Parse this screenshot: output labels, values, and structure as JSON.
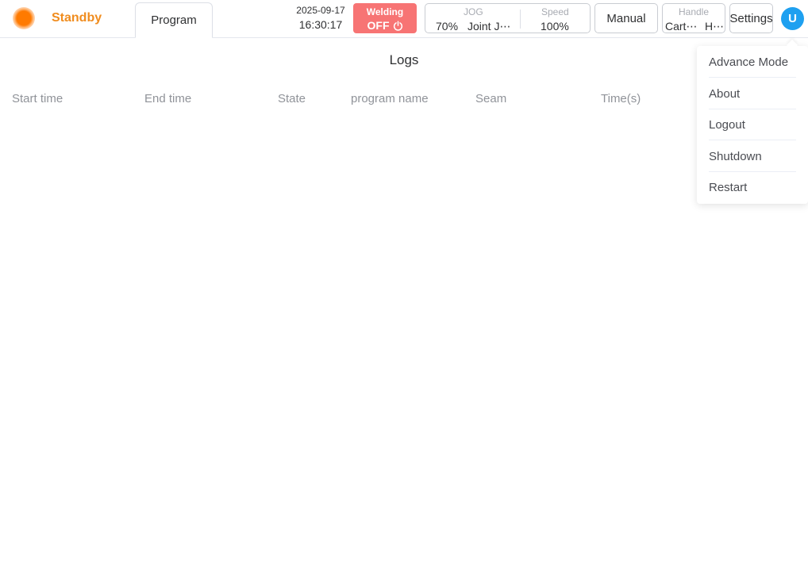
{
  "header": {
    "status_label": "Standby",
    "tab_program": "Program",
    "date": "2025-09-17",
    "time": "16:30:17",
    "welding": {
      "label": "Welding",
      "state": "OFF"
    },
    "jog": {
      "label": "JOG",
      "percent": "70%",
      "mode": "Joint J⋯"
    },
    "speed": {
      "label": "Speed",
      "value": "100%"
    },
    "manual_label": "Manual",
    "handle": {
      "label": "Handle",
      "value1": "Cart⋯",
      "value2": "H⋯"
    },
    "settings_label": "Settings",
    "avatar_initial": "U"
  },
  "logs": {
    "title": "Logs",
    "columns": [
      "Start time",
      "End time",
      "State",
      "program name",
      "Seam",
      "Time(s)"
    ]
  },
  "user_menu": {
    "items": [
      "Advance Mode",
      "About",
      "Logout",
      "Shutdown",
      "Restart"
    ]
  },
  "colors": {
    "status_orange": "#f08c1e",
    "welding_red": "#f77474",
    "avatar_blue": "#1ea0f0"
  }
}
